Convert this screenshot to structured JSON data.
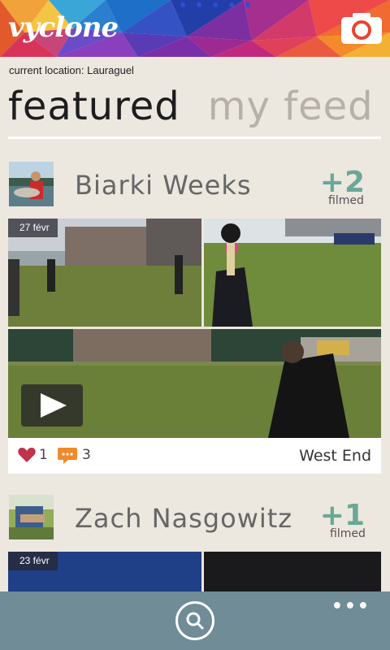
{
  "header": {
    "logo": "vyclone",
    "camera_icon": "camera-icon"
  },
  "location": "current location: Lauraguel",
  "tabs": [
    {
      "label": "featured",
      "active": true
    },
    {
      "label": "my feed",
      "active": false
    }
  ],
  "feed": [
    {
      "user": "Biarki Weeks",
      "count": "+2",
      "count_label": "filmed",
      "date": "27 févr",
      "likes": "1",
      "comments": "3",
      "place": "West End"
    },
    {
      "user": "Zach Nasgowitz",
      "count": "+1",
      "count_label": "filmed",
      "date": "23 févr"
    }
  ],
  "appbar": {
    "search_icon": "search-icon",
    "more": "•••"
  },
  "colors": {
    "accent": "#6aa896",
    "appbar": "#6f8c97",
    "background": "#ece7df",
    "heart": "#c0334a",
    "comment": "#f08a2a"
  }
}
